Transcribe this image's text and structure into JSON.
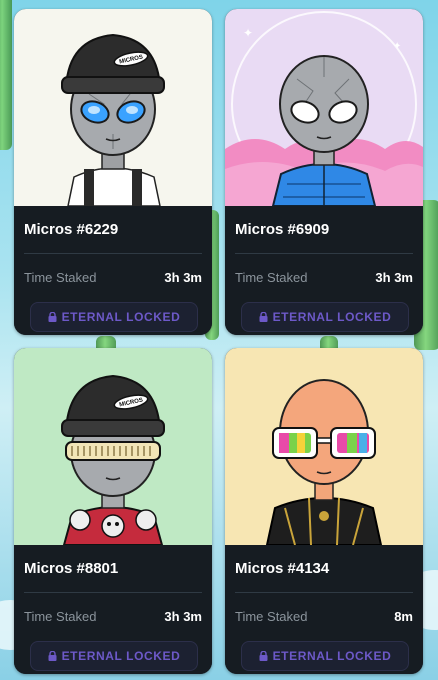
{
  "cards": [
    {
      "title": "Micros #6229",
      "stake_label": "Time Staked",
      "stake_value": "3h 3m",
      "button_label": "ETERNAL LOCKED",
      "hat_text": "MICROS"
    },
    {
      "title": "Micros #6909",
      "stake_label": "Time Staked",
      "stake_value": "3h 3m",
      "button_label": "ETERNAL LOCKED"
    },
    {
      "title": "Micros #8801",
      "stake_label": "Time Staked",
      "stake_value": "3h 3m",
      "button_label": "ETERNAL LOCKED",
      "hat_text": "MICROS"
    },
    {
      "title": "Micros #4134",
      "stake_label": "Time Staked",
      "stake_value": "8m",
      "button_label": "ETERNAL LOCKED"
    }
  ],
  "colors": {
    "accent": "#6d59c8",
    "card_bg": "#1a2127",
    "muted": "#8b949c"
  }
}
